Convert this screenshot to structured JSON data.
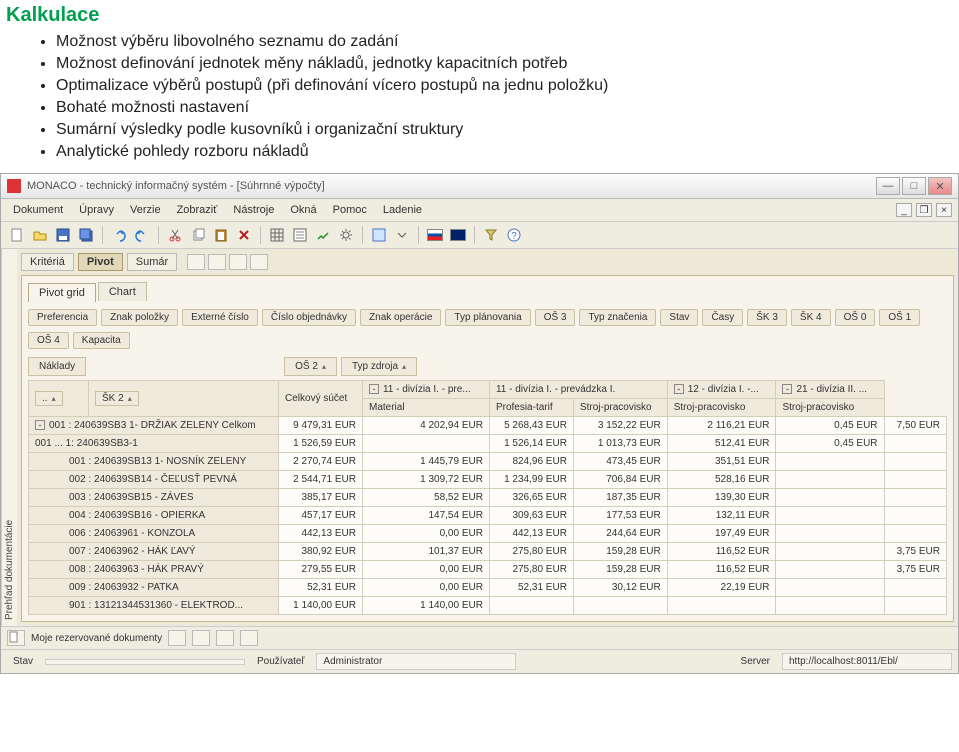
{
  "doc": {
    "title": "Kalkulace",
    "bullets": [
      "Možnost výběru libovolného seznamu do zadání",
      "Možnost definování jednotek měny nákladů, jednotky kapacitních potřeb",
      "Optimalizace výběrů postupů (při definování vícero postupů na jednu položku)",
      "Bohaté možnosti nastavení",
      "Sumární výsledky podle kusovníků i organizační struktury",
      "Analytické pohledy rozboru nákladů"
    ]
  },
  "app": {
    "title": "MONACO - technický informačný systém - [Súhrnné výpočty]",
    "menu": [
      "Dokument",
      "Úpravy",
      "Verzie",
      "Zobraziť",
      "Nástroje",
      "Okná",
      "Pomoc",
      "Ladenie"
    ],
    "side_tab": "Prehľad dokumentácie",
    "view_tabs": [
      "Kritériá",
      "Pivot",
      "Sumár"
    ],
    "sub_tabs": [
      "Pivot grid",
      "Chart"
    ],
    "filter_tags": [
      "Preferencia",
      "Znak položky",
      "Externé číslo",
      "Číslo objednávky",
      "Znak operácie",
      "Typ plánovania",
      "OŠ 3",
      "Typ značenia",
      "Stav",
      "Časy",
      "ŠK 3",
      "ŠK 4",
      "OŠ 0",
      "OŠ 1"
    ],
    "filter_tags2": [
      "OŠ 4",
      "Kapacita"
    ],
    "row_axis": {
      "naklady": "Náklady",
      "os2": "OŠ 2",
      "typ": "Typ zdroja"
    },
    "col_axis": {
      "dot": ".. ",
      "sk2": "ŠK 2"
    },
    "col_headers": {
      "total": "Celkový súčet",
      "d11pre": "11 - divízia I. - pre...",
      "d11prev": "11 - divízia I. - prevádzka I.",
      "d12": "12 - divízia I. -...",
      "d21": "21 - divízia II. ...",
      "material": "Material",
      "profesia": "Profesia-tarif",
      "stroj": "Stroj-pracovisko"
    },
    "rows": [
      {
        "c0": "001 : 240639SB3 1- DRŽIAK ZELENY Celkom",
        "c1": "9 479,31 EUR",
        "c2": "4 202,94 EUR",
        "c3": "5 268,43 EUR",
        "c4": "3 152,22 EUR",
        "c5": "2 116,21 EUR",
        "c6": "0,45 EUR",
        "c7": "7,50 EUR",
        "exp": "-"
      },
      {
        "c0": "001 ...    1: 240639SB3-1",
        "c1": "1 526,59 EUR",
        "c2": "",
        "c3": "1 526,14 EUR",
        "c4": "1 013,73 EUR",
        "c5": "512,41 EUR",
        "c6": "0,45 EUR",
        "c7": ""
      },
      {
        "c0": "001 : 240639SB13 1- NOSNÍK ZELENY",
        "c1": "2 270,74 EUR",
        "c2": "1 445,79 EUR",
        "c3": "824,96 EUR",
        "c4": "473,45 EUR",
        "c5": "351,51 EUR",
        "c6": "",
        "c7": ""
      },
      {
        "c0": "002 : 240639SB14 - ČEĽUSŤ PEVNÁ",
        "c1": "2 544,71 EUR",
        "c2": "1 309,72 EUR",
        "c3": "1 234,99 EUR",
        "c4": "706,84 EUR",
        "c5": "528,16 EUR",
        "c6": "",
        "c7": ""
      },
      {
        "c0": "003 : 240639SB15 - ZÁVES",
        "c1": "385,17 EUR",
        "c2": "58,52 EUR",
        "c3": "326,65 EUR",
        "c4": "187,35 EUR",
        "c5": "139,30 EUR",
        "c6": "",
        "c7": ""
      },
      {
        "c0": "004 : 240639SB16 - OPIERKA",
        "c1": "457,17 EUR",
        "c2": "147,54 EUR",
        "c3": "309,63 EUR",
        "c4": "177,53 EUR",
        "c5": "132,11 EUR",
        "c6": "",
        "c7": ""
      },
      {
        "c0": "006 : 24063961 - KONZOLA",
        "c1": "442,13 EUR",
        "c2": "0,00 EUR",
        "c3": "442,13 EUR",
        "c4": "244,64 EUR",
        "c5": "197,49 EUR",
        "c6": "",
        "c7": ""
      },
      {
        "c0": "007 : 24063962 - HÁK ĽAVÝ",
        "c1": "380,92 EUR",
        "c2": "101,37 EUR",
        "c3": "275,80 EUR",
        "c4": "159,28 EUR",
        "c5": "116,52 EUR",
        "c6": "",
        "c7": "3,75 EUR"
      },
      {
        "c0": "008 : 24063963 - HÁK PRAVÝ",
        "c1": "279,55 EUR",
        "c2": "0,00 EUR",
        "c3": "275,80 EUR",
        "c4": "159,28 EUR",
        "c5": "116,52 EUR",
        "c6": "",
        "c7": "3,75 EUR"
      },
      {
        "c0": "009 : 24063932 - PATKA",
        "c1": "52,31 EUR",
        "c2": "0,00 EUR",
        "c3": "52,31 EUR",
        "c4": "30,12 EUR",
        "c5": "22,19 EUR",
        "c6": "",
        "c7": ""
      },
      {
        "c0": "901 : 13121344531360   - ELEKTROD...",
        "c1": "1 140,00 EUR",
        "c2": "1 140,00 EUR",
        "c3": "",
        "c4": "",
        "c5": "",
        "c6": "",
        "c7": ""
      }
    ],
    "status": {
      "reserved": "Moje rezervované dokumenty",
      "stav": "Stav",
      "pouz": "Používateľ",
      "admin": "Administrator",
      "server": "Server",
      "url": "http://localhost:8011/Ebl/"
    }
  }
}
